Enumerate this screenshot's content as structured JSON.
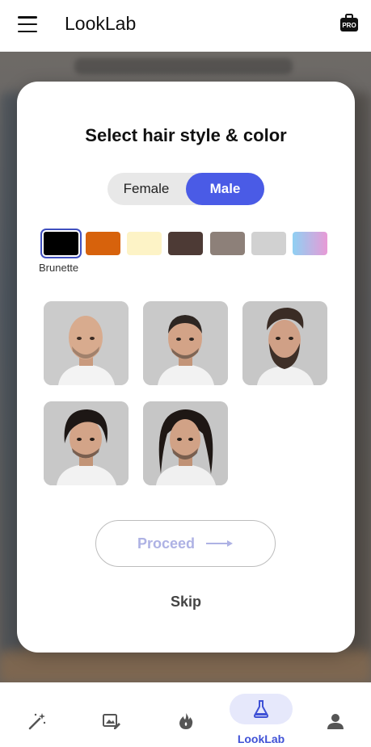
{
  "app": {
    "title": "LookLab"
  },
  "dialog": {
    "title": "Select hair style & color",
    "gender": {
      "options": [
        "Female",
        "Male"
      ],
      "selected": "Male"
    },
    "colors": {
      "swatches": [
        "#000000",
        "#d7620c",
        "#fdf3c6",
        "#4d3a35",
        "#8d8079",
        "#d1d1d1",
        "gradient-pink-blue"
      ],
      "selected_index": 0,
      "selected_label": "Brunette"
    },
    "styles": [
      {
        "name": "bald",
        "selected": false
      },
      {
        "name": "buzz-cut",
        "selected": false
      },
      {
        "name": "pompadour-beard",
        "selected": false
      },
      {
        "name": "wavy-medium",
        "selected": false
      },
      {
        "name": "long-hair",
        "selected": false
      }
    ],
    "proceed_label": "Proceed",
    "skip_label": "Skip"
  },
  "bottom_nav": {
    "items": [
      {
        "icon": "magic-wand-icon"
      },
      {
        "icon": "edit-image-icon"
      },
      {
        "icon": "fire-icon"
      },
      {
        "icon": "flask-icon",
        "label": "LookLab",
        "active": true
      },
      {
        "icon": "person-icon"
      }
    ]
  },
  "colors": {
    "accent": "#4a5be6",
    "nav_active": "#3f51d6",
    "pill": "#e6e8fb"
  }
}
